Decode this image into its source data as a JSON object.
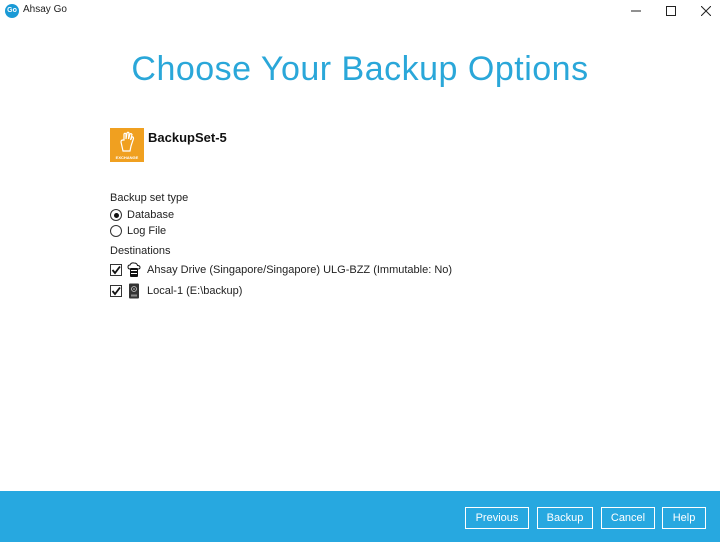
{
  "window": {
    "title": "Ahsay Go",
    "icon_text": "Go"
  },
  "page": {
    "title": "Choose Your Backup Options"
  },
  "backup_set": {
    "name": "BackupSet-5",
    "icon_caption": "EXCHANGE"
  },
  "backup_type": {
    "label": "Backup set type",
    "options": [
      {
        "label": "Database",
        "checked": true
      },
      {
        "label": "Log File",
        "checked": false
      }
    ]
  },
  "destinations": {
    "label": "Destinations",
    "items": [
      {
        "label": "Ahsay Drive (Singapore/Singapore) ULG-BZZ (Immutable: No)",
        "checked": true,
        "icon": "cloud-drive-icon"
      },
      {
        "label": "Local-1 (E:\\backup)",
        "checked": true,
        "icon": "local-drive-icon"
      }
    ]
  },
  "footer": {
    "previous": "Previous",
    "backup": "Backup",
    "cancel": "Cancel",
    "help": "Help"
  },
  "colors": {
    "accent": "#27a8e0",
    "title": "#2aa7d9",
    "exchange_icon": "#f0a020"
  }
}
